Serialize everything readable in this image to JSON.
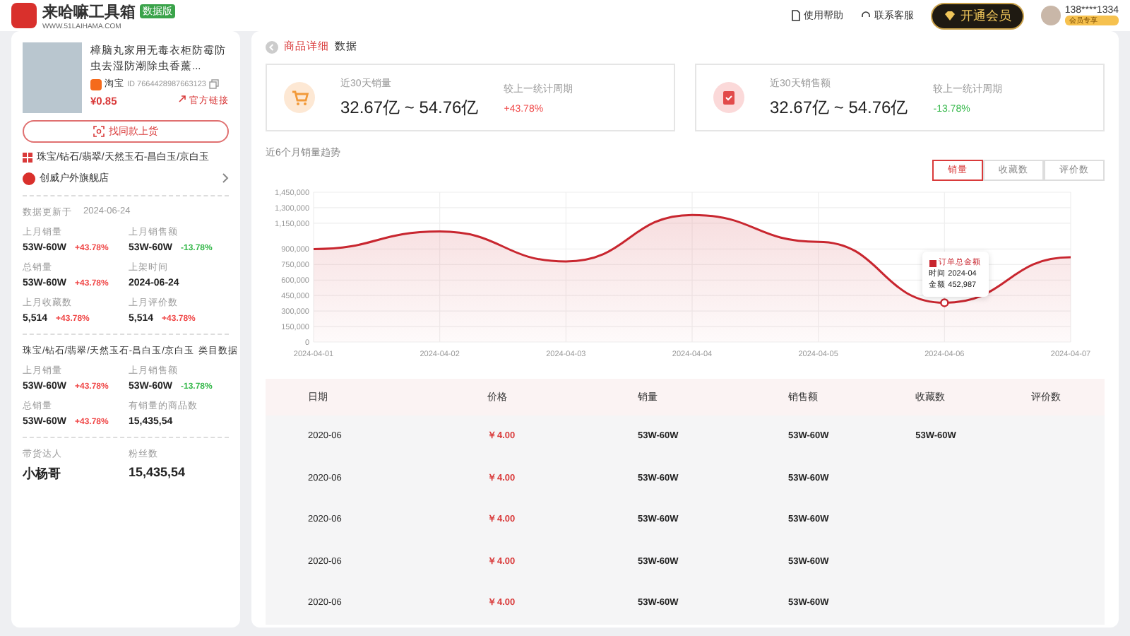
{
  "header": {
    "logo": {
      "name": "来哈嘛工具箱",
      "badge": "数据版",
      "url": "WWW.51LAIHAMA.COM"
    },
    "links": [
      "使用帮助",
      "联系客服"
    ],
    "vip_button": "开通会员",
    "user": {
      "phone": "138****1334",
      "badge": "会员专享"
    }
  },
  "product": {
    "title": "樟脑丸家用无毒衣柜防霉防虫去湿防潮除虫香薰...",
    "platform": "淘宝",
    "id": "ID 7664428987663123",
    "price": "¥0.85",
    "official_link": "官方链接",
    "find_button": "找同款上货",
    "category": "珠宝/钻石/翡翠/天然玉石-昌白玉/京白玉",
    "shop": "创威户外旗舰店",
    "updated_label": "数据更新于",
    "updated_date": "2024-06-24",
    "stats": [
      {
        "label": "上月销量",
        "value": "53W-60W",
        "change": "+43.78%",
        "color": "#f04848"
      },
      {
        "label": "上月销售额",
        "value": "53W-60W",
        "change": "-13.78%",
        "color": "#35b84a"
      },
      {
        "label": "总销量",
        "value": "53W-60W",
        "change": "+43.78%",
        "color": "#f04848"
      },
      {
        "label": "上架时间",
        "value": "2024-06-24"
      },
      {
        "label": "上月收藏数",
        "value": "5,514",
        "change": "+43.78%",
        "color": "#f04848"
      },
      {
        "label": "上月评价数",
        "value": "5,514",
        "change": "+43.78%",
        "color": "#f04848"
      }
    ],
    "category_title": "珠宝/钻石/翡翠/天然玉石-昌白玉/京白玉",
    "category_suffix": "类目数据",
    "category_stats": [
      {
        "label": "上月销量",
        "value": "53W-60W",
        "change": "+43.78%",
        "color": "#f04848"
      },
      {
        "label": "上月销售额",
        "value": "53W-60W",
        "change": "-13.78%",
        "color": "#35b84a"
      },
      {
        "label": "总销量",
        "value": "53W-60W",
        "change": "+43.78%",
        "color": "#f04848"
      },
      {
        "label": "有销量的商品数",
        "value": "15,435,54"
      }
    ],
    "influencer_stats": [
      {
        "label": "带货达人",
        "value": "小杨哥"
      },
      {
        "label": "粉丝数",
        "value": "15,435,54"
      }
    ]
  },
  "main": {
    "breadcrumb": {
      "section": "商品详细",
      "page": "数据"
    },
    "kpis": [
      {
        "kind": "cart",
        "label": "近30天销量",
        "value": "32.67亿 ~ 54.76亿",
        "compare_label": "较上一统计周期",
        "change": "+43.78%",
        "color": "#f04848"
      },
      {
        "kind": "clipboard",
        "label": "近30天销售额",
        "value": "32.67亿 ~ 54.76亿",
        "compare_label": "较上一统计周期",
        "change": "-13.78%",
        "color": "#35b84a"
      }
    ],
    "chart_title": "近6个月销量趋势",
    "chart_tabs": [
      {
        "label": "销量",
        "selected": true
      },
      {
        "label": "收藏数",
        "selected": false
      },
      {
        "label": "评价数",
        "selected": false
      }
    ],
    "chart": {
      "chart_data": {
        "type": "area",
        "categories": [
          "2024-04-01",
          "2024-04-02",
          "2024-04-03",
          "2024-04-04",
          "2024-04-05",
          "2024-04-06",
          "2024-04-07"
        ],
        "series": [
          {
            "name": "订单总金额",
            "color": "#c8262f",
            "values": [
              900000,
              1070000,
              780000,
              1230000,
              970000,
              380000,
              820000
            ]
          }
        ],
        "ylim": [
          0,
          1450000
        ],
        "grid": true,
        "yticks": [
          {
            "value": 0,
            "label": "0"
          },
          {
            "value": 150000,
            "label": "150,000"
          },
          {
            "value": 300000,
            "label": "300,000"
          },
          {
            "value": 450000,
            "label": "450,000"
          },
          {
            "value": 600000,
            "label": "600,000"
          },
          {
            "value": 750000,
            "label": "750,000"
          },
          {
            "value": 900000,
            "label": "900,000"
          },
          {
            "value": 1150000,
            "label": "1,150,000"
          },
          {
            "value": 1300000,
            "label": "1,300,000"
          },
          {
            "value": 1450000,
            "label": "1,450,000"
          }
        ]
      },
      "tooltip": {
        "time_label": "时间",
        "time": "2024-04",
        "amount_label": "金额",
        "amount": "452,987"
      }
    },
    "table": {
      "columns": [
        "日期",
        "价格",
        "销量",
        "销售额",
        "收藏数",
        "评价数"
      ],
      "rows": [
        {
          "date": "2020-06",
          "price": "￥4.00",
          "sales": "53W-60W",
          "revenue": "53W-60W",
          "favorites": "53W-60W"
        },
        {
          "date": "2020-06",
          "price": "￥4.00",
          "sales": "53W-60W",
          "revenue": "53W-60W"
        },
        {
          "date": "2020-06",
          "price": "￥4.00",
          "sales": "53W-60W",
          "revenue": "53W-60W"
        },
        {
          "date": "2020-06",
          "price": "￥4.00",
          "sales": "53W-60W",
          "revenue": "53W-60W"
        },
        {
          "date": "2020-06",
          "price": "￥4.00",
          "sales": "53W-60W",
          "revenue": "53W-60W"
        }
      ]
    }
  }
}
